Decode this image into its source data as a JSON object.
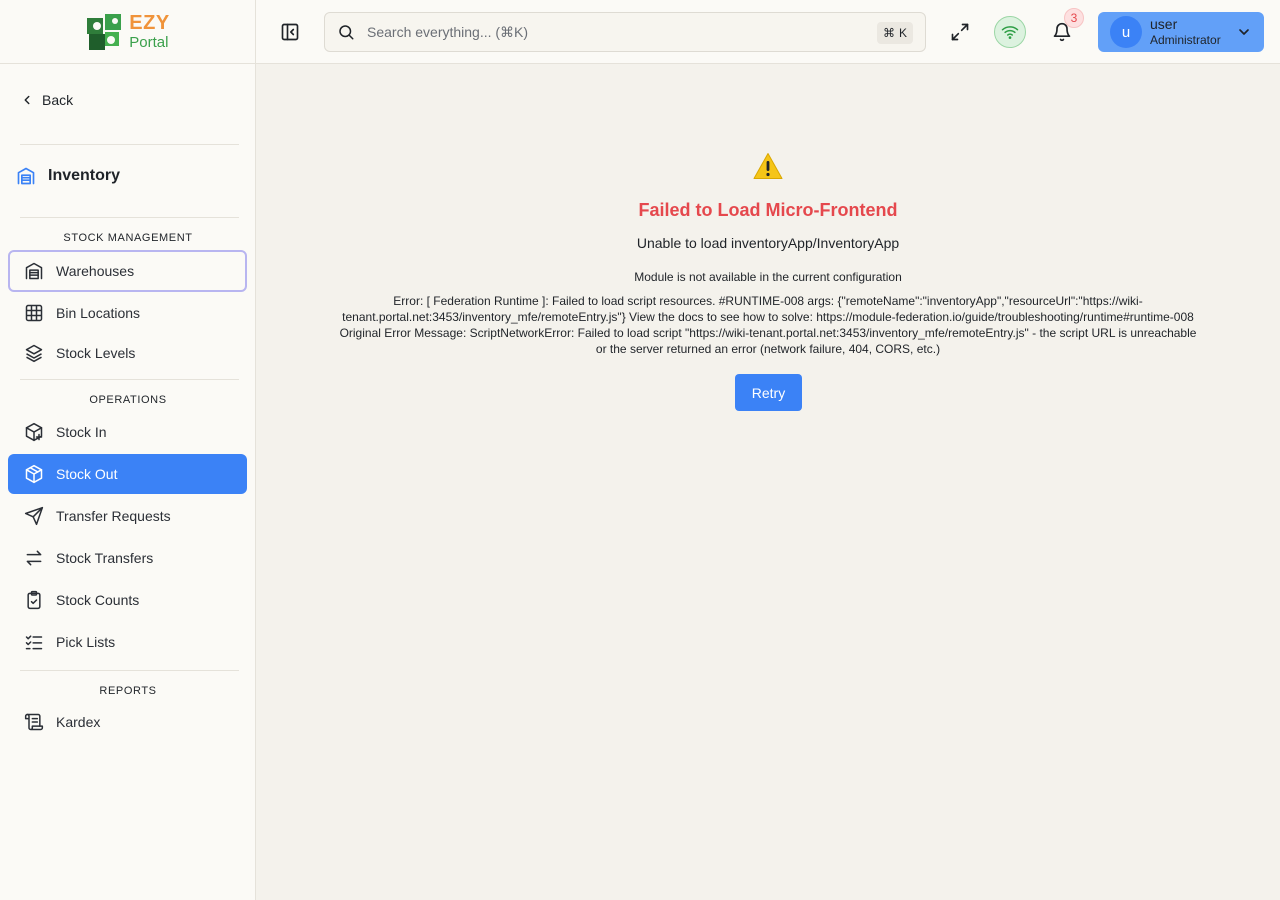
{
  "brand": {
    "name_top": "EZY",
    "name_bottom": "Portal"
  },
  "sidebar": {
    "back_label": "Back",
    "section_title": "Inventory",
    "groups": [
      {
        "label": "STOCK MANAGEMENT"
      },
      {
        "label": "OPERATIONS"
      },
      {
        "label": "REPORTS"
      }
    ],
    "items": [
      {
        "label": "Warehouses",
        "icon": "warehouse-icon",
        "state": "focused"
      },
      {
        "label": "Bin Locations",
        "icon": "grid-icon"
      },
      {
        "label": "Stock Levels",
        "icon": "layers-icon"
      },
      {
        "label": "Stock In",
        "icon": "package-plus-icon"
      },
      {
        "label": "Stock Out",
        "icon": "package-icon",
        "state": "active"
      },
      {
        "label": "Transfer Requests",
        "icon": "send-icon"
      },
      {
        "label": "Stock Transfers",
        "icon": "arrows-left-right-icon"
      },
      {
        "label": "Stock Counts",
        "icon": "clipboard-check-icon"
      },
      {
        "label": "Pick Lists",
        "icon": "list-checks-icon"
      },
      {
        "label": "Kardex",
        "icon": "scroll-icon"
      }
    ]
  },
  "header": {
    "search_placeholder": "Search everything... (⌘K)",
    "shortcut_symbol": "⌘",
    "shortcut_key": "K",
    "notification_count": "3",
    "user": {
      "initial": "u",
      "name": "user",
      "role": "Administrator"
    }
  },
  "error": {
    "icon": "warning-icon",
    "title": "Failed to Load Micro-Frontend",
    "subtitle": "Unable to load inventoryApp/InventoryApp",
    "message": "Module is not available in the current configuration",
    "detail": "Error: [ Federation Runtime ]: Failed to load script resources. #RUNTIME-008 args: {\"remoteName\":\"inventoryApp\",\"resourceUrl\":\"https://wiki-tenant.portal.net:3453/inventory_mfe/remoteEntry.js\"} View the docs to see how to solve: https://module-federation.io/guide/troubleshooting/runtime#runtime-008 Original Error Message: ScriptNetworkError: Failed to load script \"https://wiki-tenant.portal.net:3453/inventory_mfe/remoteEntry.js\" - the script URL is unreachable or the server returned an error (network failure, 404, CORS, etc.)",
    "retry_label": "Retry"
  },
  "colors": {
    "accent": "#3b82f6",
    "error": "#e5484d",
    "logo_orange": "#f0933a",
    "logo_green": "#3aa04b"
  }
}
